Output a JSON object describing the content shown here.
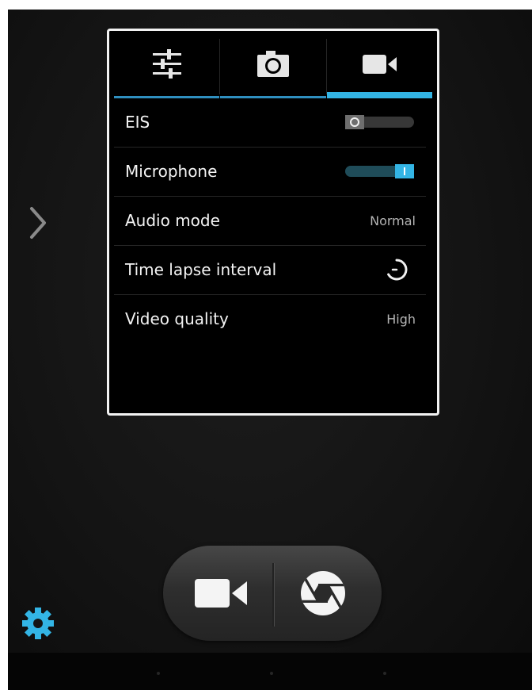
{
  "tabs": [
    {
      "icon": "sliders-icon",
      "active": false
    },
    {
      "icon": "camera-icon",
      "active": false
    },
    {
      "icon": "video-camera-icon",
      "active": true
    }
  ],
  "settings": {
    "eis": {
      "label": "EIS",
      "state": "off"
    },
    "microphone": {
      "label": "Microphone",
      "state": "on"
    },
    "audio_mode": {
      "label": "Audio mode",
      "value": "Normal"
    },
    "time_lapse": {
      "label": "Time lapse interval",
      "icon": "timer-icon"
    },
    "video_quality": {
      "label": "Video quality",
      "value": "High"
    }
  },
  "controls": {
    "mode_icon": "video-camera-icon",
    "shutter_icon": "shutter-icon",
    "settings_icon": "gear-icon",
    "expand_icon": "chevron-right-icon"
  },
  "colors": {
    "accent": "#33b5e5",
    "panel_border": "#f2f2f2",
    "background": "#111111"
  }
}
